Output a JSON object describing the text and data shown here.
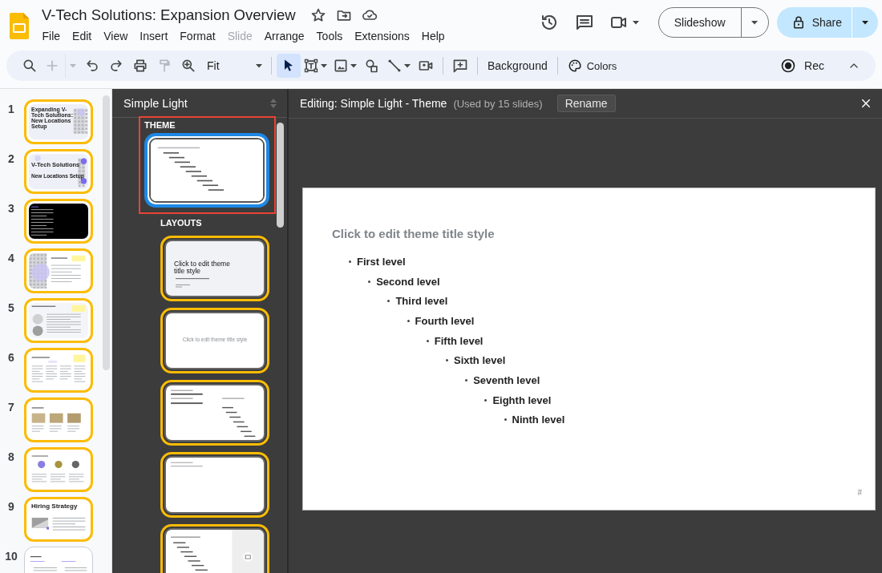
{
  "document": {
    "title": "V-Tech Solutions: Expansion Overview"
  },
  "menu": [
    {
      "label": "File",
      "disabled": false
    },
    {
      "label": "Edit",
      "disabled": false
    },
    {
      "label": "View",
      "disabled": false
    },
    {
      "label": "Insert",
      "disabled": false
    },
    {
      "label": "Format",
      "disabled": false
    },
    {
      "label": "Slide",
      "disabled": true
    },
    {
      "label": "Arrange",
      "disabled": false
    },
    {
      "label": "Tools",
      "disabled": false
    },
    {
      "label": "Extensions",
      "disabled": false
    },
    {
      "label": "Help",
      "disabled": false
    }
  ],
  "header_actions": {
    "slideshow": "Slideshow",
    "share": "Share"
  },
  "toolbar": {
    "history_tools": [
      {
        "kind": "search",
        "disabled": false
      },
      {
        "kind": "new-slide",
        "disabled": true
      },
      {
        "kind": "undo",
        "disabled": false
      },
      {
        "kind": "redo",
        "disabled": false
      },
      {
        "kind": "print",
        "disabled": false
      },
      {
        "kind": "paint-format",
        "disabled": true
      },
      {
        "kind": "zoom",
        "disabled": false
      }
    ],
    "zoom": "Fit",
    "draw_tools": [
      {
        "kind": "select",
        "selected": true
      },
      {
        "kind": "text-box",
        "selected": false
      },
      {
        "kind": "image",
        "selected": false
      },
      {
        "kind": "shape",
        "selected": false
      },
      {
        "kind": "line",
        "selected": false
      },
      {
        "kind": "video",
        "selected": false
      }
    ],
    "background": "Background",
    "colors": "Colors",
    "rec": "Rec"
  },
  "filmstrip": {
    "slides": [
      {
        "number": "1",
        "selected": true,
        "kind": "cover",
        "title": "Expanding V-Tech Solutions: New Locations Setup"
      },
      {
        "number": "2",
        "selected": true,
        "kind": "cover-circles",
        "title": "V-Tech Solutions",
        "subtitle": "New Locations Setup"
      },
      {
        "number": "3",
        "selected": true,
        "kind": "dark"
      },
      {
        "number": "4",
        "selected": true,
        "kind": "image-text"
      },
      {
        "number": "5",
        "selected": true,
        "kind": "text-note"
      },
      {
        "number": "6",
        "selected": true,
        "kind": "columns"
      },
      {
        "number": "7",
        "selected": true,
        "kind": "gallery"
      },
      {
        "number": "8",
        "selected": true,
        "kind": "circles"
      },
      {
        "number": "9",
        "selected": true,
        "kind": "image-bullets",
        "title": "Hiring Strategy"
      },
      {
        "number": "10",
        "selected": false,
        "kind": "two-column"
      }
    ]
  },
  "theme_panel": {
    "title": "Simple Light",
    "theme_heading": "THEME",
    "theme": {
      "selected": true
    },
    "layouts_heading": "LAYOUTS",
    "layouts": [
      {
        "kind": "title",
        "in_use": true,
        "title": "Click to edit theme title style"
      },
      {
        "kind": "title-only",
        "in_use": true,
        "title": "Click to edit theme title style"
      },
      {
        "kind": "section-levels",
        "in_use": true
      },
      {
        "kind": "blank-title",
        "in_use": true
      },
      {
        "kind": "levels-image",
        "in_use": true
      }
    ]
  },
  "editor": {
    "heading": "Editing: Simple Light - Theme",
    "usage": "(Used by 15 slides)",
    "rename": "Rename",
    "slide": {
      "title_placeholder": "Click to edit theme title style",
      "slide_number": "#",
      "levels": [
        {
          "text": "First level",
          "children": [
            {
              "text": "Second level",
              "children": [
                {
                  "text": "Third level",
                  "children": [
                    {
                      "text": "Fourth level",
                      "children": [
                        {
                          "text": "Fifth level",
                          "children": [
                            {
                              "text": "Sixth level",
                              "children": [
                                {
                                  "text": "Seventh level",
                                  "children": [
                                    {
                                      "text": "Eighth level",
                                      "children": [
                                        {
                                          "text": "Ninth level"
                                        }
                                      ]
                                    }
                                  ]
                                }
                              ]
                            }
                          ]
                        }
                      ]
                    }
                  ]
                }
              ]
            }
          ]
        }
      ]
    }
  }
}
